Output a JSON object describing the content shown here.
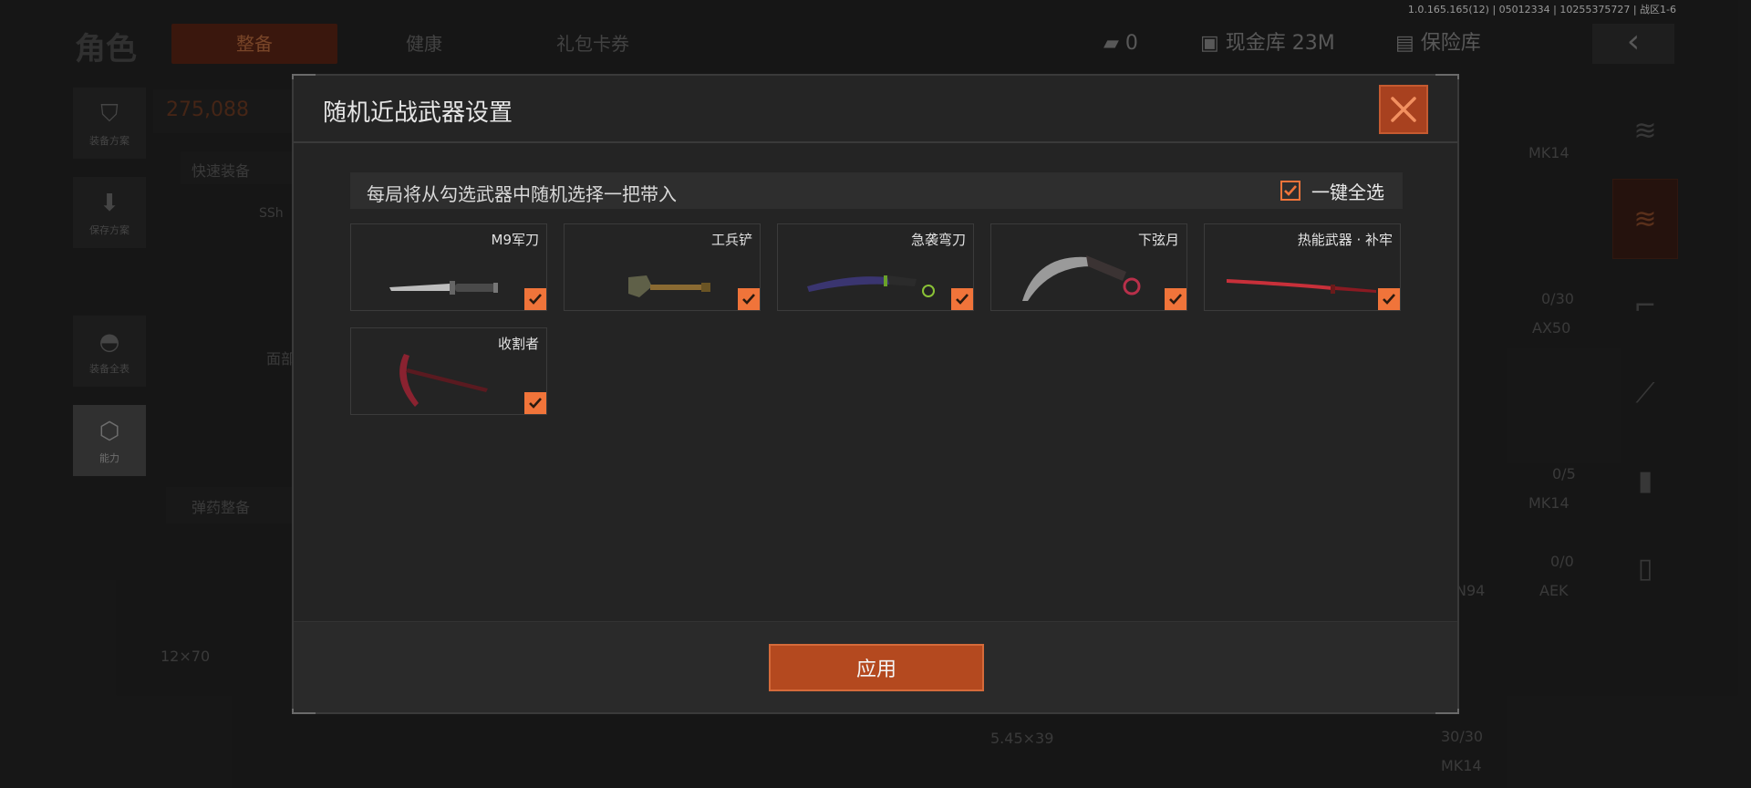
{
  "version_text": "1.0.165.165(12) | 05012334 | 10255375727 | 战区1-6",
  "background": {
    "page_title": "角色",
    "tabs": [
      {
        "label": "整备",
        "active": true
      },
      {
        "label": "健康",
        "active": false
      },
      {
        "label": "礼包卡券",
        "active": false
      }
    ],
    "currency": [
      {
        "icon": "ticket-icon",
        "value": "0"
      },
      {
        "icon": "cash-icon",
        "value": "现金库 23M"
      },
      {
        "icon": "safe-icon",
        "value": "保险库"
      }
    ],
    "left_nav": [
      {
        "icon": "vest-icon",
        "label": "装备方案"
      },
      {
        "icon": "download-icon",
        "label": "保存方案"
      },
      {
        "icon": "helmet-icon",
        "label": "装备全表"
      },
      {
        "icon": "energy-icon",
        "label": "能力"
      }
    ],
    "value_text": "275,088",
    "quick_equip": "快速装备",
    "ammo_prep": "弹药整备",
    "ammo_caliber": "12×70",
    "ammo_545": "5.45×39",
    "face_label": "面部",
    "helmet_label": "SSh",
    "right_list": [
      "MK14",
      "0/30",
      "AX50",
      "0/5",
      "MK14",
      "0/0",
      "N94",
      "AEK",
      "30/30",
      "MK14"
    ]
  },
  "modal": {
    "title": "随机近战武器设置",
    "info_text": "每局将从勾选武器中随机选择一把带入",
    "select_all_label": "一键全选",
    "select_all_checked": true,
    "weapons": [
      {
        "name": "M9军刀",
        "icon": "combat-knife-icon",
        "checked": true
      },
      {
        "name": "工兵铲",
        "icon": "shovel-icon",
        "checked": true
      },
      {
        "name": "急袭弯刀",
        "icon": "curved-blade-icon",
        "checked": true
      },
      {
        "name": "下弦月",
        "icon": "karambit-icon",
        "checked": true
      },
      {
        "name": "热能武器 · 补牢",
        "icon": "katana-icon",
        "checked": true
      },
      {
        "name": "收割者",
        "icon": "scythe-icon",
        "checked": true
      }
    ],
    "apply_label": "应用"
  },
  "colors": {
    "accent": "#f0743a",
    "button": "#b4491f",
    "close": "#a8411f"
  }
}
